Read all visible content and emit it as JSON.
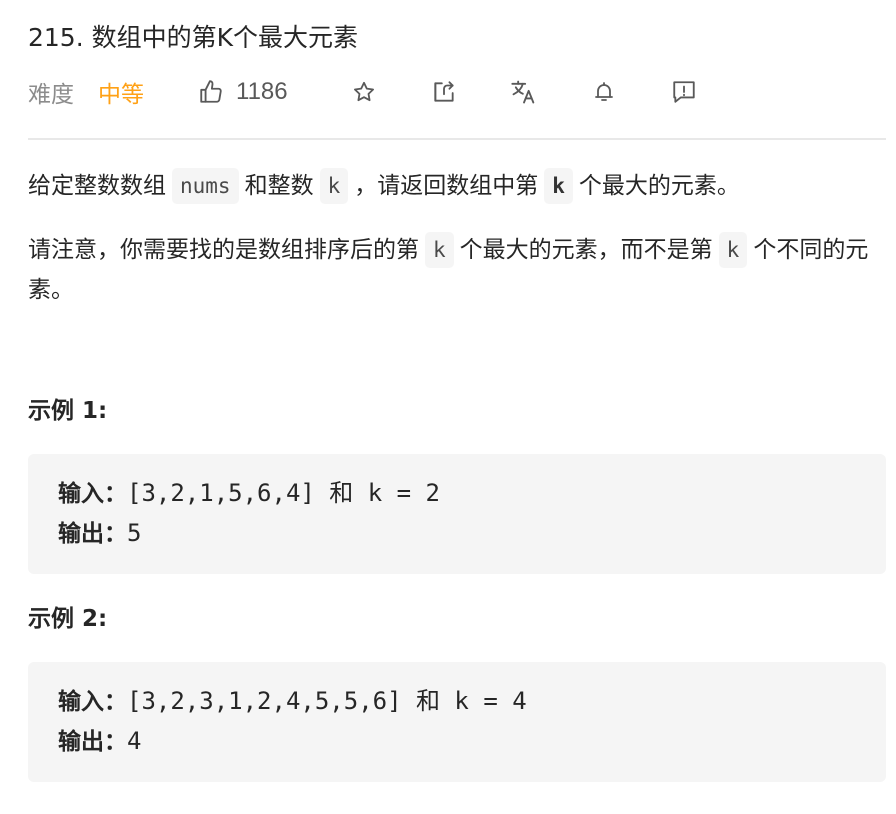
{
  "problem": {
    "title": "215. 数组中的第K个最大元素"
  },
  "meta": {
    "difficulty_label": "难度",
    "difficulty_value": "中等",
    "likes": "1186",
    "colors": {
      "difficulty_medium": "#ffa116",
      "icon": "#595959"
    },
    "icons": [
      "thumbs-up-icon",
      "star-icon",
      "share-icon",
      "translate-icon",
      "bell-icon",
      "feedback-icon"
    ]
  },
  "description": {
    "p1": {
      "t1": "给定整数数组",
      "c1": "nums",
      "t2": "和整数",
      "c2": "k",
      "t3": "，请返回数组中第",
      "c3": "k",
      "t4": "个最大的元素。"
    },
    "p2": {
      "t1": "请注意，你需要找的是数组排序后的第",
      "c1": "k",
      "t2": "个最大的元素，而不是第",
      "c2": "k",
      "t3": "个不同的元素。"
    }
  },
  "examples": [
    {
      "label": "示例 1:",
      "input_label": "输入：",
      "input_value": "[3,2,1,5,6,4] 和 k = 2",
      "output_label": "输出：",
      "output_value": "5"
    },
    {
      "label": "示例 2:",
      "input_label": "输入：",
      "input_value": "[3,2,3,1,2,4,5,5,6] 和 k = 4",
      "output_label": "输出：",
      "output_value": "4"
    }
  ]
}
